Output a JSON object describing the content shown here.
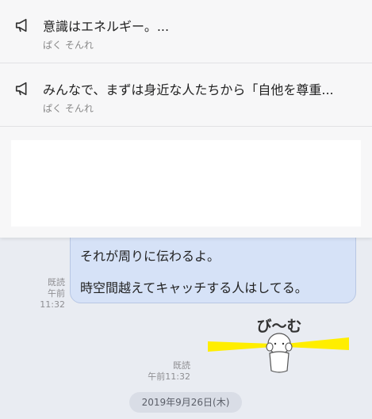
{
  "announcements": [
    {
      "title": "意識はエネルギー。...",
      "author": "ぱく そんれ"
    },
    {
      "title": "みんなで、まずは身近な人たちから「自他を尊重...",
      "author": "ぱく そんれ"
    }
  ],
  "message": {
    "lines": [
      "それが周りに伝わるよ。",
      "時空間越えてキャッチする人はしてる。"
    ],
    "read_label": "既読",
    "time": "午前11:32"
  },
  "sticker": {
    "text": "び～む",
    "read_label": "既読",
    "time": "午前11:32"
  },
  "date_separator": "2019年9月26日(木)",
  "colors": {
    "bubble": "#d6e2f7",
    "background": "#e9ecf2",
    "beam": "#ffee00"
  }
}
